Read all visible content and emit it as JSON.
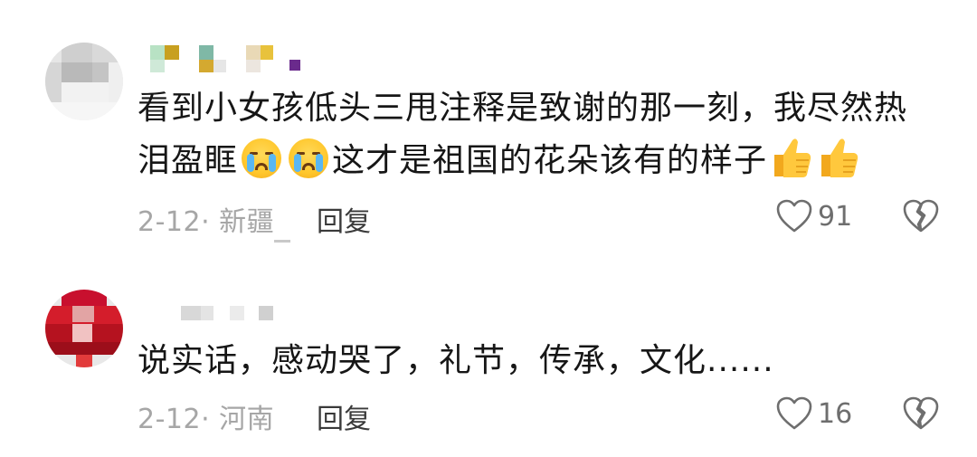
{
  "comments": [
    {
      "text_line1": "看到小女孩低头三甩注释是致谢的那一刻，我尽然热",
      "text_line2_a": "泪盈眶",
      "text_line2_b": "这才是祖国的花朵该有的样子",
      "date": "2-12",
      "location": "新疆",
      "reply_label": "回复",
      "like_count": "91",
      "emojis": [
        "loudly-crying-face",
        "loudly-crying-face",
        "thumbs-up",
        "thumbs-up"
      ]
    },
    {
      "text_line1": "说实话，感动哭了，礼节，传承，文化......",
      "date": "2-12",
      "location": "河南",
      "reply_label": "回复",
      "like_count": "16"
    }
  ],
  "colors": {
    "meta_gray": "#a6a6a6",
    "text": "#161616",
    "reply": "#3a3a3a",
    "icon": "#6e6e6e"
  }
}
